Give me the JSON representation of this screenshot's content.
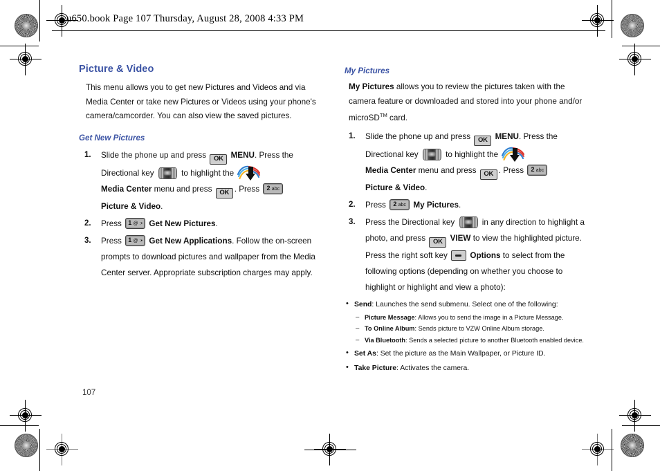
{
  "slug": "u650.book  Page 107  Thursday, August 28, 2008  4:33 PM",
  "folio": "107",
  "colors": {
    "heading": "#3b53a4",
    "body": "#111111",
    "key_face": "#cfcfcf",
    "key_border": "#3a3a3a"
  },
  "icons": {
    "ok_key": "OK",
    "num1_big": "1",
    "num1_small": "@ :•",
    "num2_big": "2",
    "num2_small": "abc",
    "directional_key": "directional-key",
    "media_center": "media-center-icon",
    "soft_key": "right-soft-key"
  },
  "left_column": {
    "heading": "Picture & Video",
    "intro": "This menu allows you to get new Pictures and Videos and via Media Center or take new Pictures or Videos using your phone's camera/camcorder. You can also view the saved pictures.",
    "subheading": "Get New Pictures",
    "steps": [
      {
        "num": "1.",
        "t1": "Slide the phone up and press ",
        "b1": "MENU",
        "t2": ". Press the Directional key ",
        "t3": " to highlight the ",
        "b2": "Media Center",
        "t4": " menu and press ",
        "t5": ". Press ",
        "b3": "Picture & Video",
        "t6": "."
      },
      {
        "num": "2.",
        "t1": "Press ",
        "b1": "Get New Pictures",
        "t2": "."
      },
      {
        "num": "3.",
        "t1": "Press ",
        "b1": "Get New Applications",
        "t2": ". Follow the on-screen prompts to download pictures and wallpaper from the Media Center server. Appropriate subscription charges may apply."
      }
    ]
  },
  "right_column": {
    "subheading": "My Pictures",
    "intro_bold": "My Pictures",
    "intro_rest": " allows you to review the pictures taken with the camera feature or downloaded and stored into your phone and/or microSD",
    "intro_tm": "TM",
    "intro_tail": " card.",
    "steps": [
      {
        "num": "1.",
        "t1": "Slide the phone up and press ",
        "b1": "MENU",
        "t2": ". Press the Directional key ",
        "t3": " to highlight the ",
        "b2": "Media Center",
        "t4": " menu and press ",
        "t5": ". Press ",
        "b3": "Picture & Video",
        "t6": "."
      },
      {
        "num": "2.",
        "t1": "Press ",
        "b1": "My Pictures",
        "t2": "."
      },
      {
        "num": "3.",
        "t1": "Press the Directional key ",
        "t2": " in any direction to highlight a photo, and press ",
        "b1": "VIEW",
        "t3": " to view the highlighted picture. Press the right soft key ",
        "b2": "Options",
        "t4": " to select from the following options (depending on whether you choose to highlight or highlight and view a photo):"
      }
    ],
    "options": [
      {
        "label": "Send",
        "desc": ": Launches the send submenu. Select one of the following:",
        "sub": [
          {
            "label": "Picture Message",
            "desc": ": Allows you to send the image in a Picture Message."
          },
          {
            "label": "To Online Album",
            "desc": ": Sends picture to VZW Online Album storage."
          },
          {
            "label": "Via Bluetooth",
            "desc": ": Sends a selected picture to another Bluetooth enabled device."
          }
        ]
      },
      {
        "label": "Set As",
        "desc": ": Set the picture as the Main Wallpaper, or Picture ID.",
        "sub": []
      },
      {
        "label": "Take Picture",
        "desc": ": Activates the camera.",
        "sub": []
      }
    ]
  }
}
